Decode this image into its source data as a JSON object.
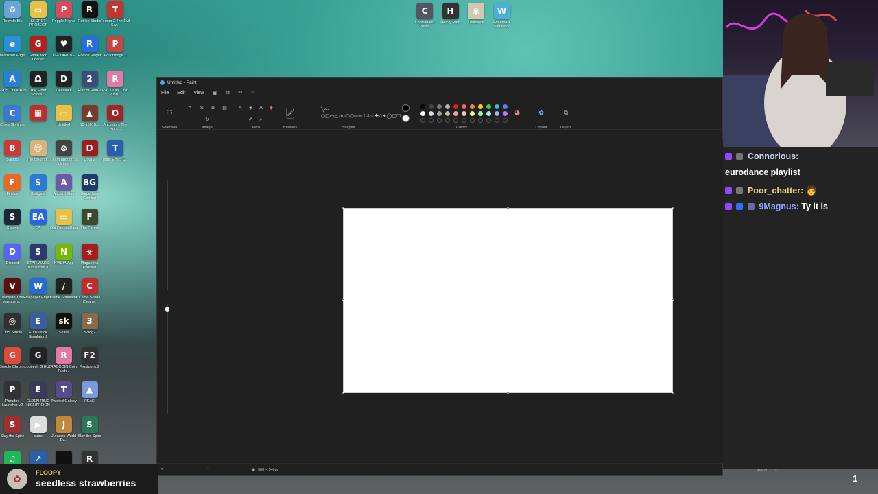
{
  "desktop": {
    "icons": [
      {
        "label": "Recycle Bin",
        "color": "#6ba4d8",
        "glyph": "♻"
      },
      {
        "label": "SECRET PROJECT",
        "color": "#e9c14a",
        "glyph": "▭"
      },
      {
        "label": "Peggle Nights",
        "color": "#d94a5a",
        "glyph": "P"
      },
      {
        "label": "Roblox Studio",
        "color": "#111111",
        "glyph": "R"
      },
      {
        "label": "Tomba 2 The Evil Sw...",
        "color": "#c7342e",
        "glyph": "T"
      },
      {
        "label": "Microsoft Edge",
        "color": "#2b8fd8",
        "glyph": "e"
      },
      {
        "label": "Game Mod Loader",
        "color": "#b02020",
        "glyph": "G"
      },
      {
        "label": "DELTARUNE",
        "color": "#222222",
        "glyph": "♥"
      },
      {
        "label": "Roblox Player",
        "color": "#2a6de0",
        "glyph": "R"
      },
      {
        "label": "Poly Bridge 3",
        "color": "#c84545",
        "glyph": "P"
      },
      {
        "label": "ASUS DriverHub",
        "color": "#2c7fd0",
        "glyph": "A"
      },
      {
        "label": "The Elder Scrolls...",
        "color": "#222222",
        "glyph": "Ω"
      },
      {
        "label": "Deadlock",
        "color": "#222222",
        "glyph": "D"
      },
      {
        "label": "Risk of Rain 2",
        "color": "#3b4e7a",
        "glyph": "2"
      },
      {
        "label": "RACCOIN Coin Push...",
        "color": "#e27aa6",
        "glyph": "R"
      },
      {
        "label": "Cities Skylines",
        "color": "#3a7ad0",
        "glyph": "C"
      },
      {
        "label": "",
        "color": "#b83030",
        "glyph": "▦"
      },
      {
        "label": "Untitled",
        "color": "#e9c14a",
        "glyph": "▭"
      },
      {
        "label": "15-15018...",
        "color": "#7a3b2a",
        "glyph": "▲"
      },
      {
        "label": "Ancestors The Hum...",
        "color": "#a02525",
        "glyph": "O"
      },
      {
        "label": "Balatro",
        "color": "#c63c3c",
        "glyph": "B"
      },
      {
        "label": "The Binding...",
        "color": "#d9b37a",
        "glyph": "☺"
      },
      {
        "label": "Learn about this picture",
        "color": "#444444",
        "glyph": "⊗"
      },
      {
        "label": "Dota 2",
        "color": "#9a2020",
        "glyph": "D"
      },
      {
        "label": "Tetris Effect C...",
        "color": "#2a5fb0",
        "glyph": "T"
      },
      {
        "label": "Firefox",
        "color": "#e86a25",
        "glyph": "F"
      },
      {
        "label": "Splitgate",
        "color": "#2a7ad8",
        "glyph": "S"
      },
      {
        "label": "Ancient King",
        "color": "#6a5aa8",
        "glyph": "A"
      },
      {
        "label": "Borderless Gaming",
        "color": "#1d3a6a",
        "glyph": "BG"
      },
      {
        "label": "",
        "color": "#00000000",
        "glyph": ""
      },
      {
        "label": "Steam",
        "color": "#1b2838",
        "glyph": "S"
      },
      {
        "label": "EA",
        "color": "#2a66e0",
        "glyph": "EA"
      },
      {
        "label": "Old Firefox Data",
        "color": "#e9c14a",
        "glyph": "▭"
      },
      {
        "label": "The Forest",
        "color": "#3a4a2a",
        "glyph": "F"
      },
      {
        "label": "",
        "color": "#00000000",
        "glyph": ""
      },
      {
        "label": "Discord",
        "color": "#5865f2",
        "glyph": "D"
      },
      {
        "label": "STAR WARS Battlefront II",
        "color": "#2b3a6a",
        "glyph": "S"
      },
      {
        "label": "NVIDIA App",
        "color": "#76b900",
        "glyph": "N"
      },
      {
        "label": "Plague Inc Evolved",
        "color": "#a81c1c",
        "glyph": "☣"
      },
      {
        "label": "",
        "color": "#00000000",
        "glyph": ""
      },
      {
        "label": "Vampire The Masquera...",
        "color": "#5a1010",
        "glyph": "V"
      },
      {
        "label": "Wallpaper Engine",
        "color": "#2a6ad0",
        "glyph": "W"
      },
      {
        "label": "Crime Simulator",
        "color": "#222222",
        "glyph": "/"
      },
      {
        "label": "Crime Scene Cleaner",
        "color": "#c42a2a",
        "glyph": "C"
      },
      {
        "label": "",
        "color": "#00000000",
        "glyph": ""
      },
      {
        "label": "OBS Studio",
        "color": "#303030",
        "glyph": "◎"
      },
      {
        "label": "Euro Truck Simulator 2",
        "color": "#3a5fa0",
        "glyph": "E"
      },
      {
        "label": "Skate",
        "color": "#111111",
        "glyph": "sk"
      },
      {
        "label": "3vilog?",
        "color": "#8a6a4a",
        "glyph": "3"
      },
      {
        "label": "",
        "color": "#00000000",
        "glyph": ""
      },
      {
        "label": "Google Chrome",
        "color": "#e04a3a",
        "glyph": "G"
      },
      {
        "label": "Logitech G HUB",
        "color": "#222222",
        "glyph": "G"
      },
      {
        "label": "RACCOIN Coin Push...",
        "color": "#e27aa6",
        "glyph": "R"
      },
      {
        "label": "Frostpunk 2",
        "color": "#333333",
        "glyph": "F2"
      },
      {
        "label": "",
        "color": "#00000000",
        "glyph": ""
      },
      {
        "label": "Paradox Launcher v2",
        "color": "#333333",
        "glyph": "P"
      },
      {
        "label": "ELDEN RING NIGHTREIGN",
        "color": "#3a3a5a",
        "glyph": "E"
      },
      {
        "label": "Twisted Gallery",
        "color": "#5a4a8a",
        "glyph": "T"
      },
      {
        "label": "PEAK",
        "color": "#7a9ae0",
        "glyph": "▲"
      },
      {
        "label": "",
        "color": "#00000000",
        "glyph": ""
      },
      {
        "label": "Slay the Spire",
        "color": "#a03030",
        "glyph": "S"
      },
      {
        "label": "outro",
        "color": "#dddddd",
        "glyph": "▶"
      },
      {
        "label": "Jurassic World Ev...",
        "color": "#c08a3a",
        "glyph": "J"
      },
      {
        "label": "Slay the Spire",
        "color": "#2a7a5a",
        "glyph": "S"
      },
      {
        "label": "",
        "color": "#00000000",
        "glyph": ""
      },
      {
        "label": "",
        "color": "#1db954",
        "glyph": "♫"
      },
      {
        "label": "",
        "color": "#2a5fb0",
        "glyph": "↗"
      },
      {
        "label": "",
        "color": "#111111",
        "glyph": ""
      },
      {
        "label": "",
        "color": "#333333",
        "glyph": "R"
      }
    ],
    "top_icons": [
      {
        "label": "Contraband Police",
        "color": "#555566",
        "glyph": "C"
      },
      {
        "label": "Heavy Rain",
        "color": "#333333",
        "glyph": "H"
      },
      {
        "label": "Deadlock",
        "color": "#d0c8b0",
        "glyph": "◉"
      },
      {
        "label": "Waterpark Simulator",
        "color": "#4ab0d8",
        "glyph": "W"
      }
    ]
  },
  "paint": {
    "title": "Untitled - Paint",
    "menu": [
      "File",
      "Edit",
      "View"
    ],
    "quick_access": [
      "save-icon",
      "open-icon",
      "undo-icon",
      "redo-icon"
    ],
    "groups": {
      "selection": "Selection",
      "image": "Image",
      "tools": "Tools",
      "brushes": "Brushes",
      "shapes": "Shapes",
      "colors": "Colors",
      "copilot": "Copilot",
      "layers": "Layers"
    },
    "colors": {
      "primary": "#000000",
      "secondary": "#ffffff",
      "palette": [
        "#000000",
        "#464646",
        "#787878",
        "#b4b4b4",
        "#dc1e1e",
        "#f06464",
        "#f08c28",
        "#f0c828",
        "#46c846",
        "#1ec8c8",
        "#6478f0",
        "#ffffff",
        "#dcdcdc",
        "#a0a0a0",
        "#c8b4a0",
        "#f0a0a0",
        "#f0c8a0",
        "#f0f0a0",
        "#a0f0a0",
        "#a0f0f0",
        "#a0b4f0",
        "#b478f0"
      ],
      "empty_slots": 11
    },
    "status": {
      "canvas_size": "960 × 540px",
      "zoom": "100%"
    }
  },
  "chat": {
    "messages": [
      {
        "user": "Connorious:",
        "user_color": "#c8d7f0",
        "text": ""
      },
      {
        "user": "",
        "user_color": "#ffffff",
        "text": "eurodance playlist"
      },
      {
        "user": "Poor_chatter:",
        "user_color": "#f2cf86",
        "text": ""
      },
      {
        "user": "9Magnus:",
        "user_color": "#8fa6ff",
        "text": "Ty it is"
      }
    ]
  },
  "alert": {
    "user": "FLOOPY",
    "message": "seedless strawberries"
  },
  "overlay": {
    "count": "1"
  }
}
